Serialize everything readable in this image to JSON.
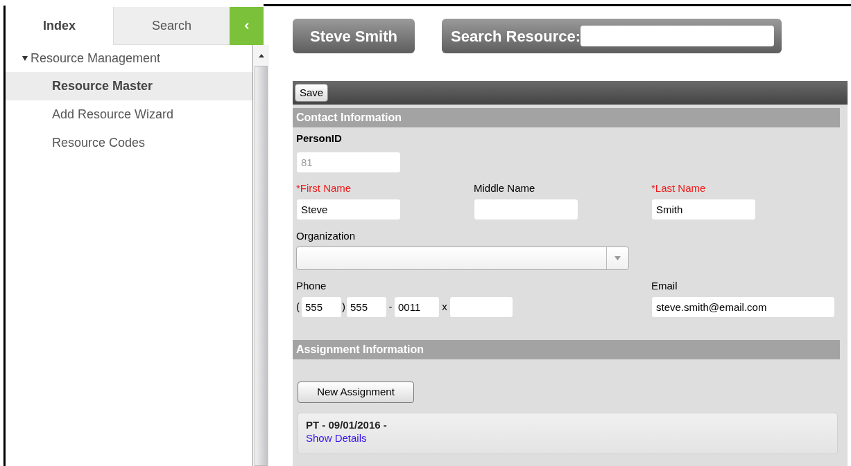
{
  "sidebar": {
    "tabs": [
      {
        "label": "Index",
        "selected": true
      },
      {
        "label": "Search",
        "selected": false
      }
    ],
    "tree": [
      {
        "label": "Resource Management",
        "expanded": true,
        "children": [
          {
            "label": "Resource Master",
            "selected": true
          },
          {
            "label": "Add Resource Wizard",
            "selected": false
          },
          {
            "label": "Resource Codes",
            "selected": false
          }
        ]
      }
    ]
  },
  "header": {
    "user_button": "Steve Smith",
    "search_label": "Search Resource:"
  },
  "toolbar": {
    "save_button": "Save"
  },
  "contact": {
    "title": "Contact Information",
    "person_id": {
      "label": "PersonID",
      "value": "81",
      "disabled": true
    },
    "names": [
      {
        "label": "*First Name",
        "required": true,
        "value": "Steve"
      },
      {
        "label": "Middle Name",
        "required": false
      },
      {
        "label": "*Last Name",
        "required": true,
        "value": "Smith"
      }
    ],
    "organization": {
      "label": "Organization"
    },
    "phone": {
      "label": "Phone",
      "open_paren": "(",
      "area": "555",
      "close_paren": ")",
      "prefix": "555",
      "dash": "-",
      "line": "0011",
      "ext_mark": "x"
    },
    "email": {
      "label": "Email",
      "value": "steve.smith@email.com"
    }
  },
  "assignment": {
    "title": "Assignment Information",
    "new_button": "New Assignment",
    "items": [
      {
        "title": "PT - 09/01/2016 -",
        "link": "Show Details"
      }
    ]
  }
}
